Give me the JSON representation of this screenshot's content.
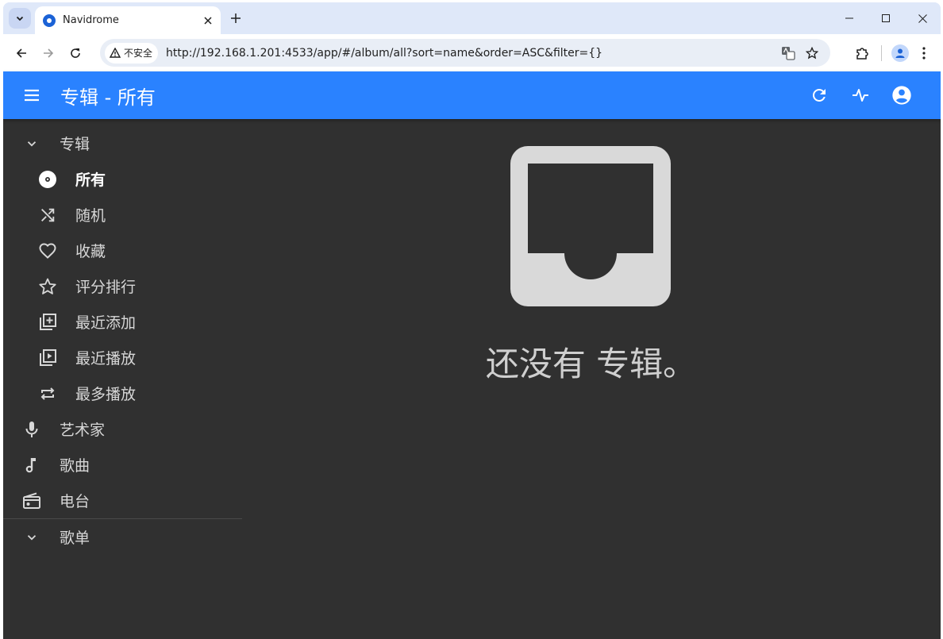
{
  "browser": {
    "tab_title": "Navidrome",
    "security_label": "不安全",
    "url": "http://192.168.1.201:4533/app/#/album/all?sort=name&order=ASC&filter={}"
  },
  "appbar": {
    "title": "专辑 - 所有"
  },
  "sidebar": {
    "albums_label": "专辑",
    "album_items": [
      {
        "label": "所有",
        "icon": "album-disc-icon"
      },
      {
        "label": "随机",
        "icon": "shuffle-icon"
      },
      {
        "label": "收藏",
        "icon": "heart-icon"
      },
      {
        "label": "评分排行",
        "icon": "star-icon"
      },
      {
        "label": "最近添加",
        "icon": "library-add-icon"
      },
      {
        "label": "最近播放",
        "icon": "video-library-icon"
      },
      {
        "label": "最多播放",
        "icon": "repeat-icon"
      }
    ],
    "artists_label": "艺术家",
    "songs_label": "歌曲",
    "radio_label": "电台",
    "playlists_label": "歌单"
  },
  "empty_state": {
    "message": "还没有 专辑。"
  },
  "colors": {
    "appbar": "#2a82ff",
    "background": "#303030",
    "sidebar_text": "#d7d7d7",
    "empty_icon": "#d9d9d9"
  }
}
